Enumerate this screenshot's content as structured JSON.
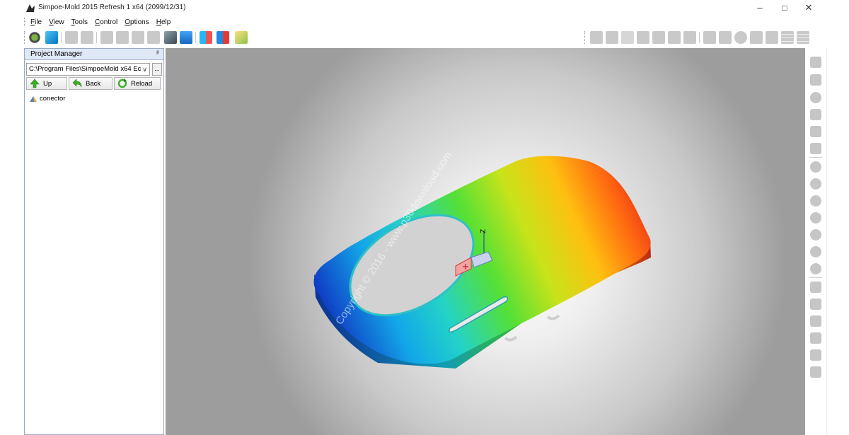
{
  "window": {
    "title": "Simpoe-Mold 2015 Refresh 1 x64  (2099/12/31)",
    "controls": {
      "minimize": "–",
      "maximize": "□",
      "close": "✕"
    }
  },
  "menu": [
    {
      "mnemonic": "F",
      "rest": "ile"
    },
    {
      "mnemonic": "V",
      "rest": "iew"
    },
    {
      "mnemonic": "T",
      "rest": "ools"
    },
    {
      "mnemonic": "C",
      "rest": "ontrol"
    },
    {
      "mnemonic": "O",
      "rest": "ptions"
    },
    {
      "mnemonic": "H",
      "rest": "elp"
    }
  ],
  "toolbar_icons": [
    "new-project-icon",
    "open-icon",
    "folder-icon",
    "tree-icon",
    "mesh-icon",
    "tools-icon",
    "refresh-icon",
    "gates-icon",
    "monitor-icon",
    "display-icon",
    "chart-icon",
    "colors-icon",
    "run-icon"
  ],
  "view_icons": [
    "solid-icon",
    "shaded-icon",
    "wire-icon",
    "box-icon",
    "cut-icon",
    "mold-icon",
    "fill-icon",
    "node-icon",
    "arrows-icon",
    "sphere-icon",
    "grid-icon",
    "part-icon",
    "table-icon",
    "table-2-icon"
  ],
  "project_manager": {
    "title": "Project Manager",
    "pin": "ᵖ",
    "path": "C:\\Program Files\\SimpoeMold x64 Ec",
    "browse": "...",
    "buttons": {
      "up": "Up",
      "back": "Back",
      "reload": "Reload"
    },
    "items": [
      "conector"
    ]
  },
  "viewport": {
    "axis_label": "Z",
    "watermark": "Copyright © 2016 - www.p30download.com"
  },
  "right_tools": [
    "rotate-icon",
    "select-icon",
    "zoom-icon",
    "pan-icon",
    "fit-icon",
    "orbit-icon",
    "view-iso-icon",
    "view-front-icon",
    "view-back-icon",
    "view-left-icon",
    "view-right-icon",
    "view-top-icon",
    "view-bottom-icon",
    "render-icon",
    "clip-icon",
    "light-icon",
    "measure-icon",
    "section-icon",
    "tool-icon"
  ],
  "colors": {
    "header_bg": "#dfe8f6",
    "accent_blue": "#1f5fbf"
  }
}
